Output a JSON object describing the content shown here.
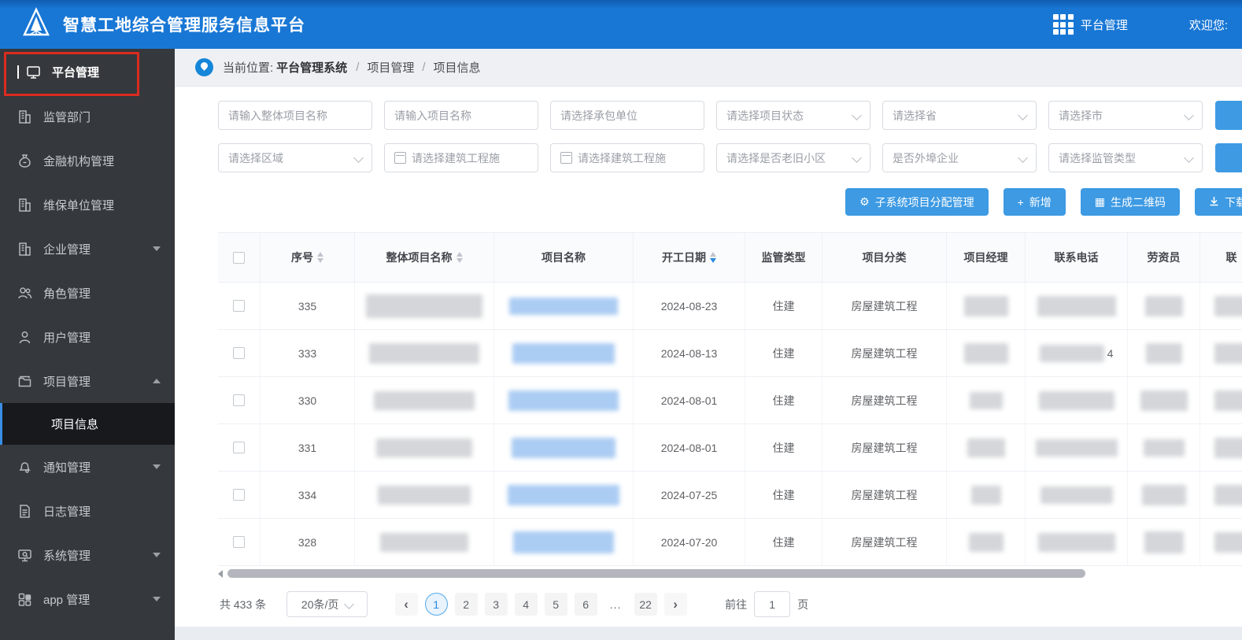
{
  "header": {
    "title": "智慧工地综合管理服务信息平台",
    "nav_label": "平台管理",
    "welcome": "欢迎您:"
  },
  "sidebar": {
    "items": [
      {
        "label": "平台管理",
        "icon": "monitor-icon",
        "active": true
      },
      {
        "label": "监管部门",
        "icon": "building-icon"
      },
      {
        "label": "金融机构管理",
        "icon": "moneybag-icon"
      },
      {
        "label": "维保单位管理",
        "icon": "building-icon"
      },
      {
        "label": "企业管理",
        "icon": "building-icon",
        "expandable": true,
        "state": "collapsed"
      },
      {
        "label": "角色管理",
        "icon": "users-icon"
      },
      {
        "label": "用户管理",
        "icon": "user-icon"
      },
      {
        "label": "项目管理",
        "icon": "folder-icon",
        "expandable": true,
        "state": "expanded",
        "children": [
          {
            "label": "项目信息",
            "active": true
          }
        ]
      },
      {
        "label": "通知管理",
        "icon": "bell-icon",
        "expandable": true,
        "state": "collapsed"
      },
      {
        "label": "日志管理",
        "icon": "document-icon"
      },
      {
        "label": "系统管理",
        "icon": "system-icon",
        "expandable": true,
        "state": "collapsed"
      },
      {
        "label": "app 管理",
        "icon": "app-grid-icon",
        "expandable": true,
        "state": "collapsed"
      }
    ]
  },
  "breadcrumb": {
    "prefix": "当前位置:",
    "root": "平台管理系统",
    "sep": "/",
    "items": [
      "项目管理",
      "项目信息"
    ]
  },
  "filters": {
    "row1": [
      {
        "placeholder": "请输入整体项目名称",
        "type": "text"
      },
      {
        "placeholder": "请输入项目名称",
        "type": "text"
      },
      {
        "placeholder": "请选择承包单位",
        "type": "select"
      },
      {
        "placeholder": "请选择项目状态",
        "type": "select"
      },
      {
        "placeholder": "请选择省",
        "type": "select"
      },
      {
        "placeholder": "请选择市",
        "type": "select"
      }
    ],
    "row2": [
      {
        "placeholder": "请选择区域",
        "type": "select"
      },
      {
        "placeholder": "请选择建筑工程施",
        "type": "date"
      },
      {
        "placeholder": "请选择建筑工程施",
        "type": "date"
      },
      {
        "placeholder": "请选择是否老旧小区",
        "type": "select"
      },
      {
        "placeholder": "是否外埠企业",
        "type": "select"
      },
      {
        "placeholder": "请选择监管类型",
        "type": "select"
      }
    ]
  },
  "actions": [
    {
      "label": "子系统项目分配管理",
      "icon": "gear-icon"
    },
    {
      "label": "新增",
      "icon": "plus-icon"
    },
    {
      "label": "生成二维码",
      "icon": "qrcode-icon"
    },
    {
      "label": "下载",
      "icon": "download-icon",
      "truncated": true
    }
  ],
  "table": {
    "columns": {
      "c0": "",
      "c1": "序号",
      "c2": "整体项目名称",
      "c3": "项目名称",
      "c4": "开工日期",
      "c5": "监管类型",
      "c6": "项目分类",
      "c7": "项目经理",
      "c8": "联系电话",
      "c9": "劳资员",
      "c10": "联"
    },
    "sort": {
      "seq": "none",
      "overall_name": "none",
      "start_date": "desc"
    },
    "rows": [
      {
        "seq": "335",
        "start_date": "2024-08-23",
        "supervision": "住建",
        "category": "房屋建筑工程",
        "redacted": true
      },
      {
        "seq": "333",
        "start_date": "2024-08-13",
        "supervision": "住建",
        "category": "房屋建筑工程",
        "redacted": true,
        "phone_tail": "4"
      },
      {
        "seq": "330",
        "start_date": "2024-08-01",
        "supervision": "住建",
        "category": "房屋建筑工程",
        "redacted": true
      },
      {
        "seq": "331",
        "start_date": "2024-08-01",
        "supervision": "住建",
        "category": "房屋建筑工程",
        "redacted": true
      },
      {
        "seq": "334",
        "start_date": "2024-07-25",
        "supervision": "住建",
        "category": "房屋建筑工程",
        "redacted": true
      },
      {
        "seq": "328",
        "start_date": "2024-07-20",
        "supervision": "住建",
        "category": "房屋建筑工程",
        "redacted": true
      }
    ]
  },
  "pagination": {
    "total": "共 433 条",
    "page_size": "20条/页",
    "prev": "‹",
    "next": "›",
    "pages": {
      "p0": "1",
      "p1": "2",
      "p2": "3",
      "p3": "4",
      "p4": "5",
      "p5": "6",
      "p6": "...",
      "p7": "22"
    },
    "current": "1",
    "goto_prefix": "前往",
    "goto_value": "1",
    "goto_suffix": "页"
  },
  "colors": {
    "header_blue": "#1877d5",
    "button_blue": "#3d9ae3",
    "sidebar_dark": "#35383c",
    "annotation_red": "#d92c1f",
    "link_blue": "#abccf3"
  }
}
